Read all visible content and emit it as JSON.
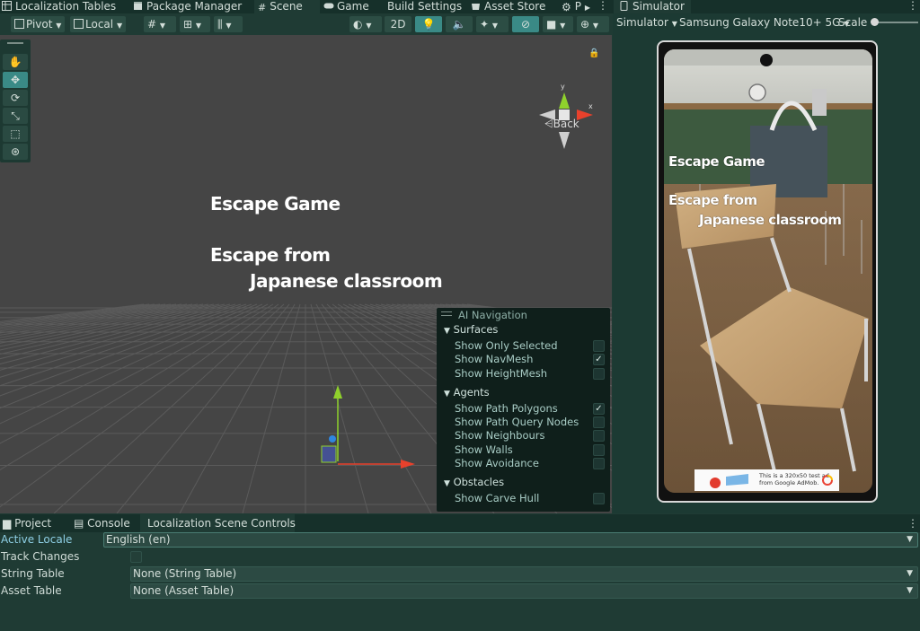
{
  "tabs": {
    "localization_tables": "Localization Tables",
    "package_manager": "Package Manager",
    "scene": "Scene",
    "game": "Game",
    "build_settings": "Build Settings",
    "asset_store": "Asset Store",
    "settings_short": "P",
    "simulator": "Simulator"
  },
  "scene_toolbar": {
    "pivot": "Pivot",
    "local": "Local",
    "mode_2d": "2D"
  },
  "scene": {
    "title_line": "Escape Game",
    "subtitle_line1": "Escape from",
    "subtitle_line2": "Japanese classroom",
    "back_label": "Back",
    "gizmo_axis_y": "y",
    "gizmo_axis_x": "x"
  },
  "ai_navigation": {
    "title": "AI Navigation",
    "surfaces": {
      "heading": "Surfaces",
      "items": [
        {
          "label": "Show Only Selected",
          "checked": false
        },
        {
          "label": "Show NavMesh",
          "checked": true
        },
        {
          "label": "Show HeightMesh",
          "checked": false
        }
      ]
    },
    "agents": {
      "heading": "Agents",
      "items": [
        {
          "label": "Show Path Polygons",
          "checked": true
        },
        {
          "label": "Show Path Query Nodes",
          "checked": false
        },
        {
          "label": "Show Neighbours",
          "checked": false
        },
        {
          "label": "Show Walls",
          "checked": false
        },
        {
          "label": "Show Avoidance",
          "checked": false
        }
      ]
    },
    "obstacles": {
      "heading": "Obstacles",
      "items": [
        {
          "label": "Show Carve Hull",
          "checked": false
        }
      ]
    }
  },
  "simulator": {
    "mode": "Simulator",
    "device": "Samsung Galaxy Note10+ 5G",
    "scale_label": "Scale",
    "scale_value": 0.05,
    "screen_title": "Escape Game",
    "screen_sub1": "Escape from",
    "screen_sub2": "Japanese classroom",
    "ad_line1": "This is a 320x50 test ad",
    "ad_line2": "from Google AdMob."
  },
  "bottom_tabs": {
    "project": "Project",
    "console": "Console",
    "localization_scene_controls": "Localization Scene Controls"
  },
  "localization_controls": {
    "active_locale_label": "Active Locale",
    "active_locale_value": "English (en)",
    "track_changes_label": "Track Changes",
    "track_changes_checked": false,
    "string_table_label": "String Table",
    "string_table_value": "None (String Table)",
    "asset_table_label": "Asset Table",
    "asset_table_value": "None (Asset Table)"
  },
  "colors": {
    "panel_bg": "#1f3b34",
    "tab_bar_bg": "#16302a",
    "scene_bg": "#454545",
    "accent": "#3a8a86",
    "gizmo_x": "#e8412c",
    "gizmo_y": "#8fd12c"
  }
}
